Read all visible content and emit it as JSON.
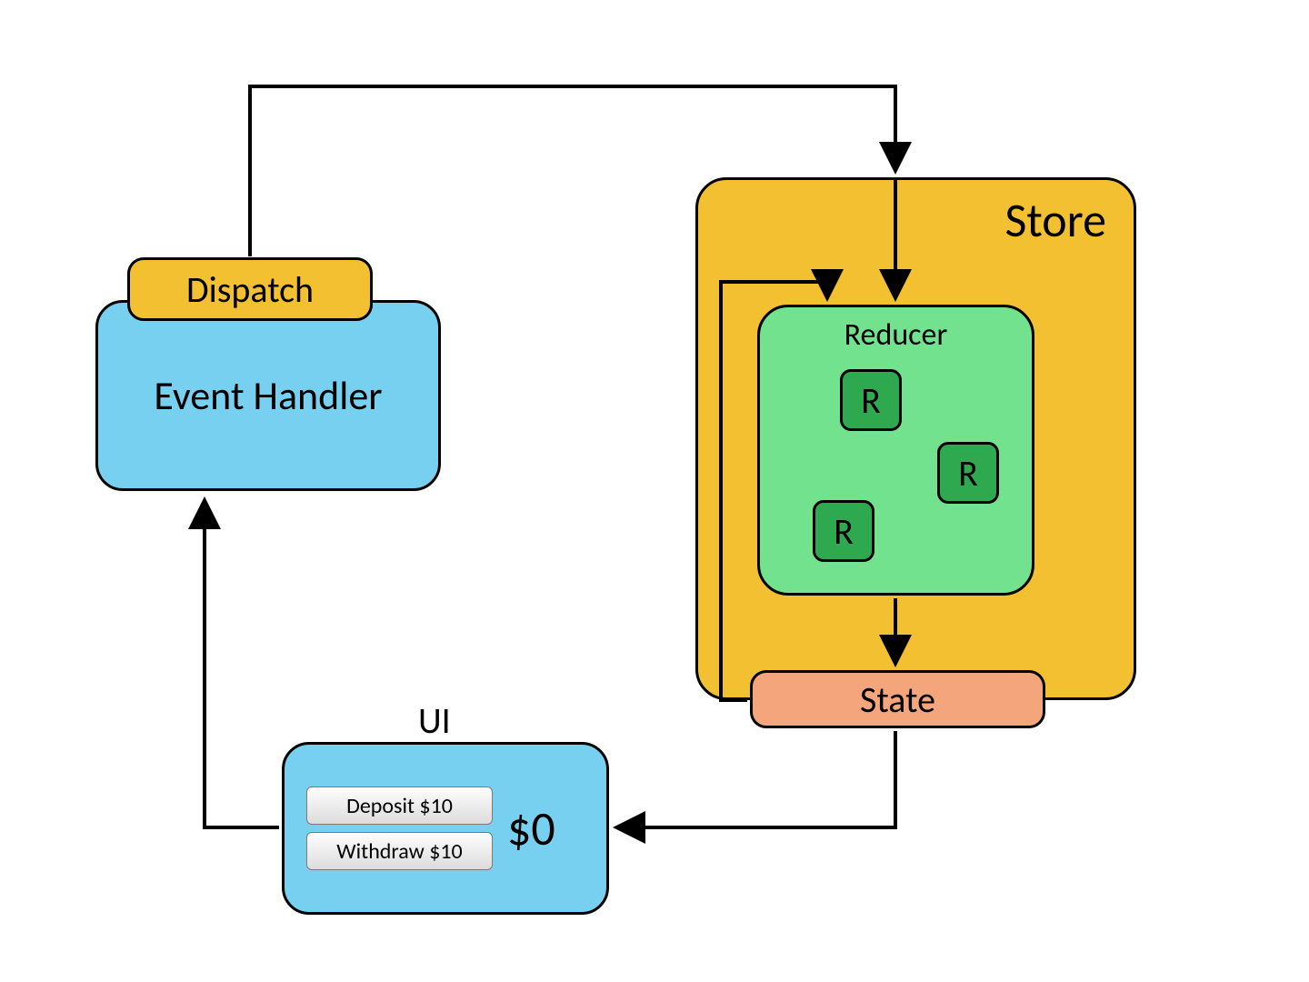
{
  "store_label": "Store",
  "reducer_label": "Reducer",
  "r_letter": "R",
  "state_label": "State",
  "event_handler_label": "Event Handler",
  "dispatch_label": "Dispatch",
  "ui_title": "UI",
  "deposit_button": "Deposit $10",
  "withdraw_button": "Withdraw $10",
  "balance": "$0"
}
